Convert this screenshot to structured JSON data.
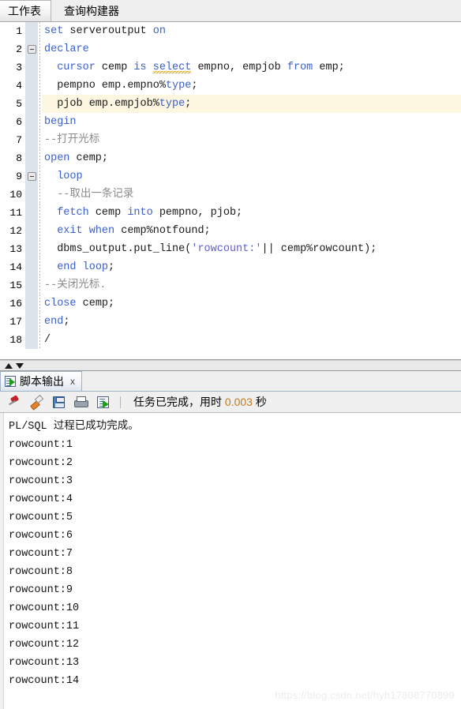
{
  "worksheet_tabs": [
    {
      "label": "工作表",
      "active": true
    },
    {
      "label": "查询构建器",
      "active": false
    }
  ],
  "editor": {
    "lines": [
      {
        "num": "1",
        "fold": false,
        "highlight": false,
        "tokens": [
          {
            "t": "set",
            "c": "kw"
          },
          {
            "t": " serveroutput ",
            "c": "plain"
          },
          {
            "t": "on",
            "c": "kw"
          }
        ]
      },
      {
        "num": "2",
        "fold": true,
        "highlight": false,
        "tokens": [
          {
            "t": "declare",
            "c": "kw"
          }
        ]
      },
      {
        "num": "3",
        "fold": false,
        "highlight": false,
        "tokens": [
          {
            "t": "  ",
            "c": "plain"
          },
          {
            "t": "cursor",
            "c": "kw"
          },
          {
            "t": " cemp ",
            "c": "plain"
          },
          {
            "t": "is",
            "c": "kw"
          },
          {
            "t": " ",
            "c": "plain"
          },
          {
            "t": "select",
            "c": "kw sq"
          },
          {
            "t": " empno, empjob ",
            "c": "plain"
          },
          {
            "t": "from",
            "c": "kw"
          },
          {
            "t": " emp;",
            "c": "plain"
          }
        ]
      },
      {
        "num": "4",
        "fold": false,
        "highlight": false,
        "tokens": [
          {
            "t": "  pempno emp.empno%",
            "c": "plain"
          },
          {
            "t": "type",
            "c": "kw"
          },
          {
            "t": ";",
            "c": "plain"
          }
        ]
      },
      {
        "num": "5",
        "fold": false,
        "highlight": true,
        "tokens": [
          {
            "t": "  pjob emp.empjob%",
            "c": "plain"
          },
          {
            "t": "type",
            "c": "kw"
          },
          {
            "t": ";",
            "c": "plain"
          }
        ]
      },
      {
        "num": "6",
        "fold": false,
        "highlight": false,
        "tokens": [
          {
            "t": "begin",
            "c": "kw"
          }
        ]
      },
      {
        "num": "7",
        "fold": false,
        "highlight": false,
        "tokens": [
          {
            "t": "--打开光标",
            "c": "cmt"
          }
        ]
      },
      {
        "num": "8",
        "fold": false,
        "highlight": false,
        "tokens": [
          {
            "t": "open",
            "c": "kw"
          },
          {
            "t": " cemp;",
            "c": "plain"
          }
        ]
      },
      {
        "num": "9",
        "fold": true,
        "highlight": false,
        "tokens": [
          {
            "t": "  ",
            "c": "plain"
          },
          {
            "t": "loop",
            "c": "kw"
          }
        ]
      },
      {
        "num": "10",
        "fold": false,
        "highlight": false,
        "tokens": [
          {
            "t": "  --取出一条记录",
            "c": "cmt"
          }
        ]
      },
      {
        "num": "11",
        "fold": false,
        "highlight": false,
        "tokens": [
          {
            "t": "  ",
            "c": "plain"
          },
          {
            "t": "fetch",
            "c": "kw"
          },
          {
            "t": " cemp ",
            "c": "plain"
          },
          {
            "t": "into",
            "c": "kw"
          },
          {
            "t": " pempno, pjob;",
            "c": "plain"
          }
        ]
      },
      {
        "num": "12",
        "fold": false,
        "highlight": false,
        "tokens": [
          {
            "t": "  ",
            "c": "plain"
          },
          {
            "t": "exit",
            "c": "kw"
          },
          {
            "t": " ",
            "c": "plain"
          },
          {
            "t": "when",
            "c": "kw"
          },
          {
            "t": " cemp%notfound;",
            "c": "plain"
          }
        ]
      },
      {
        "num": "13",
        "fold": false,
        "highlight": false,
        "tokens": [
          {
            "t": "  dbms_output.put_line(",
            "c": "plain"
          },
          {
            "t": "'rowcount:'",
            "c": "str"
          },
          {
            "t": "|| cemp%rowcount);",
            "c": "plain"
          }
        ]
      },
      {
        "num": "14",
        "fold": false,
        "highlight": false,
        "tokens": [
          {
            "t": "  ",
            "c": "plain"
          },
          {
            "t": "end",
            "c": "kw"
          },
          {
            "t": " ",
            "c": "plain"
          },
          {
            "t": "loop",
            "c": "kw"
          },
          {
            "t": ";",
            "c": "plain"
          }
        ]
      },
      {
        "num": "15",
        "fold": false,
        "highlight": false,
        "tokens": [
          {
            "t": "--关闭光标.",
            "c": "cmt"
          }
        ]
      },
      {
        "num": "16",
        "fold": false,
        "highlight": false,
        "tokens": [
          {
            "t": "close",
            "c": "kw"
          },
          {
            "t": " cemp;",
            "c": "plain"
          }
        ]
      },
      {
        "num": "17",
        "fold": false,
        "highlight": false,
        "tokens": [
          {
            "t": "end",
            "c": "kw"
          },
          {
            "t": ";",
            "c": "plain"
          }
        ]
      },
      {
        "num": "18",
        "fold": false,
        "highlight": false,
        "tokens": [
          {
            "t": "/",
            "c": "plain"
          }
        ]
      }
    ]
  },
  "output_panel": {
    "tab_label": "脚本输出",
    "tab_close_label": "x",
    "toolbar": {
      "buttons": [
        {
          "name": "pin-icon",
          "cls": "ic-pin"
        },
        {
          "name": "eraser-icon",
          "cls": "ic-eraser"
        },
        {
          "name": "save-icon",
          "cls": "ic-save"
        },
        {
          "name": "print-icon",
          "cls": "ic-print"
        },
        {
          "name": "run-script-icon",
          "cls": "ic-run"
        }
      ],
      "status_prefix": "任务已完成，用时 ",
      "status_number": "0.003",
      "status_suffix": " 秒"
    },
    "lines": [
      "PL/SQL 过程已成功完成。",
      "rowcount:1",
      "rowcount:2",
      "rowcount:3",
      "rowcount:4",
      "rowcount:5",
      "rowcount:6",
      "rowcount:7",
      "rowcount:8",
      "rowcount:9",
      "rowcount:10",
      "rowcount:11",
      "rowcount:12",
      "rowcount:13",
      "rowcount:14"
    ]
  },
  "watermark": "https://blog.csdn.net/hyh17808770899"
}
